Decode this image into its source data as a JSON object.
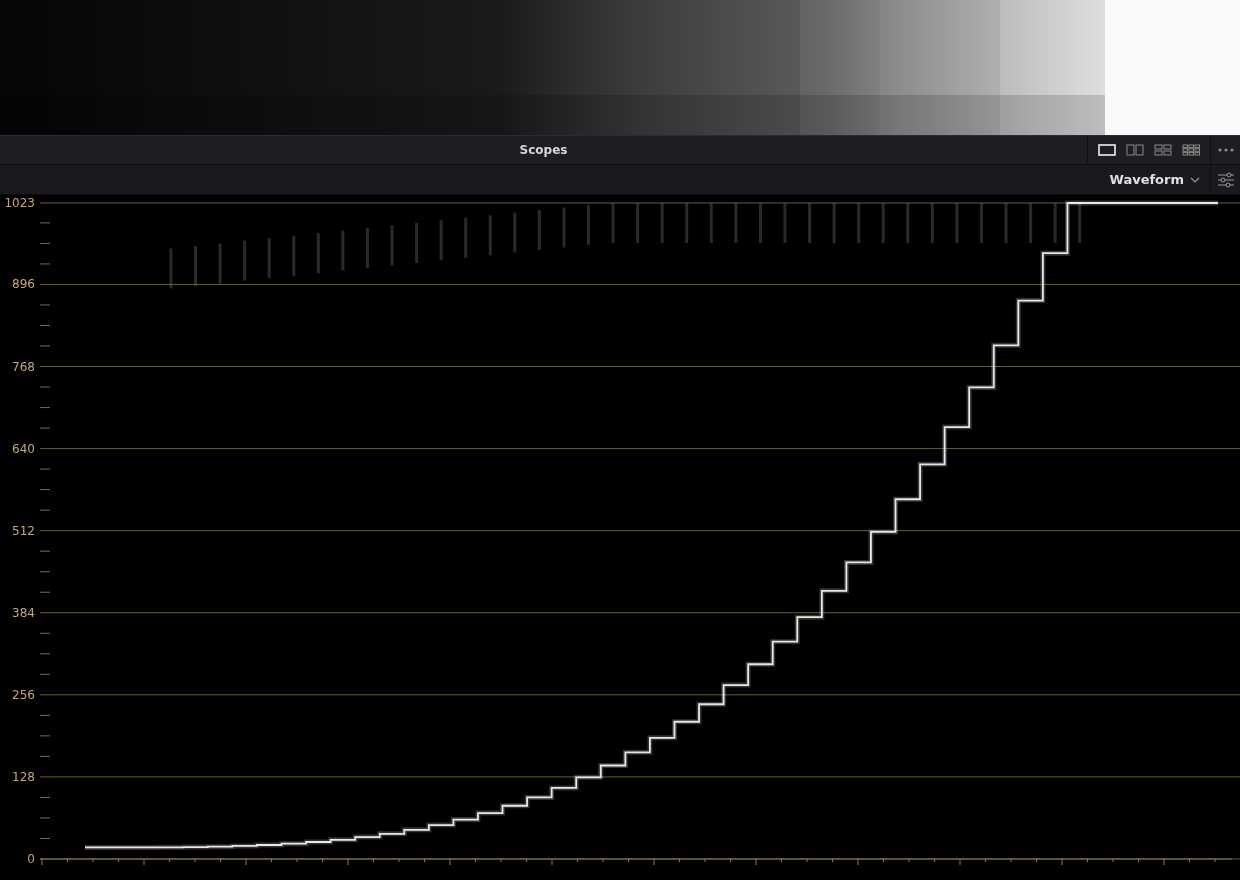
{
  "panel": {
    "title": "Scopes"
  },
  "layouts": [
    {
      "kind": "single",
      "selected": true
    },
    {
      "kind": "dual",
      "selected": false
    },
    {
      "kind": "quad",
      "selected": false
    },
    {
      "kind": "grid",
      "selected": false
    }
  ],
  "scope_type": {
    "value": "Waveform"
  },
  "y_axis": {
    "labels": [
      "1023",
      "896",
      "768",
      "640",
      "512",
      "384",
      "256",
      "128",
      "0"
    ]
  }
}
